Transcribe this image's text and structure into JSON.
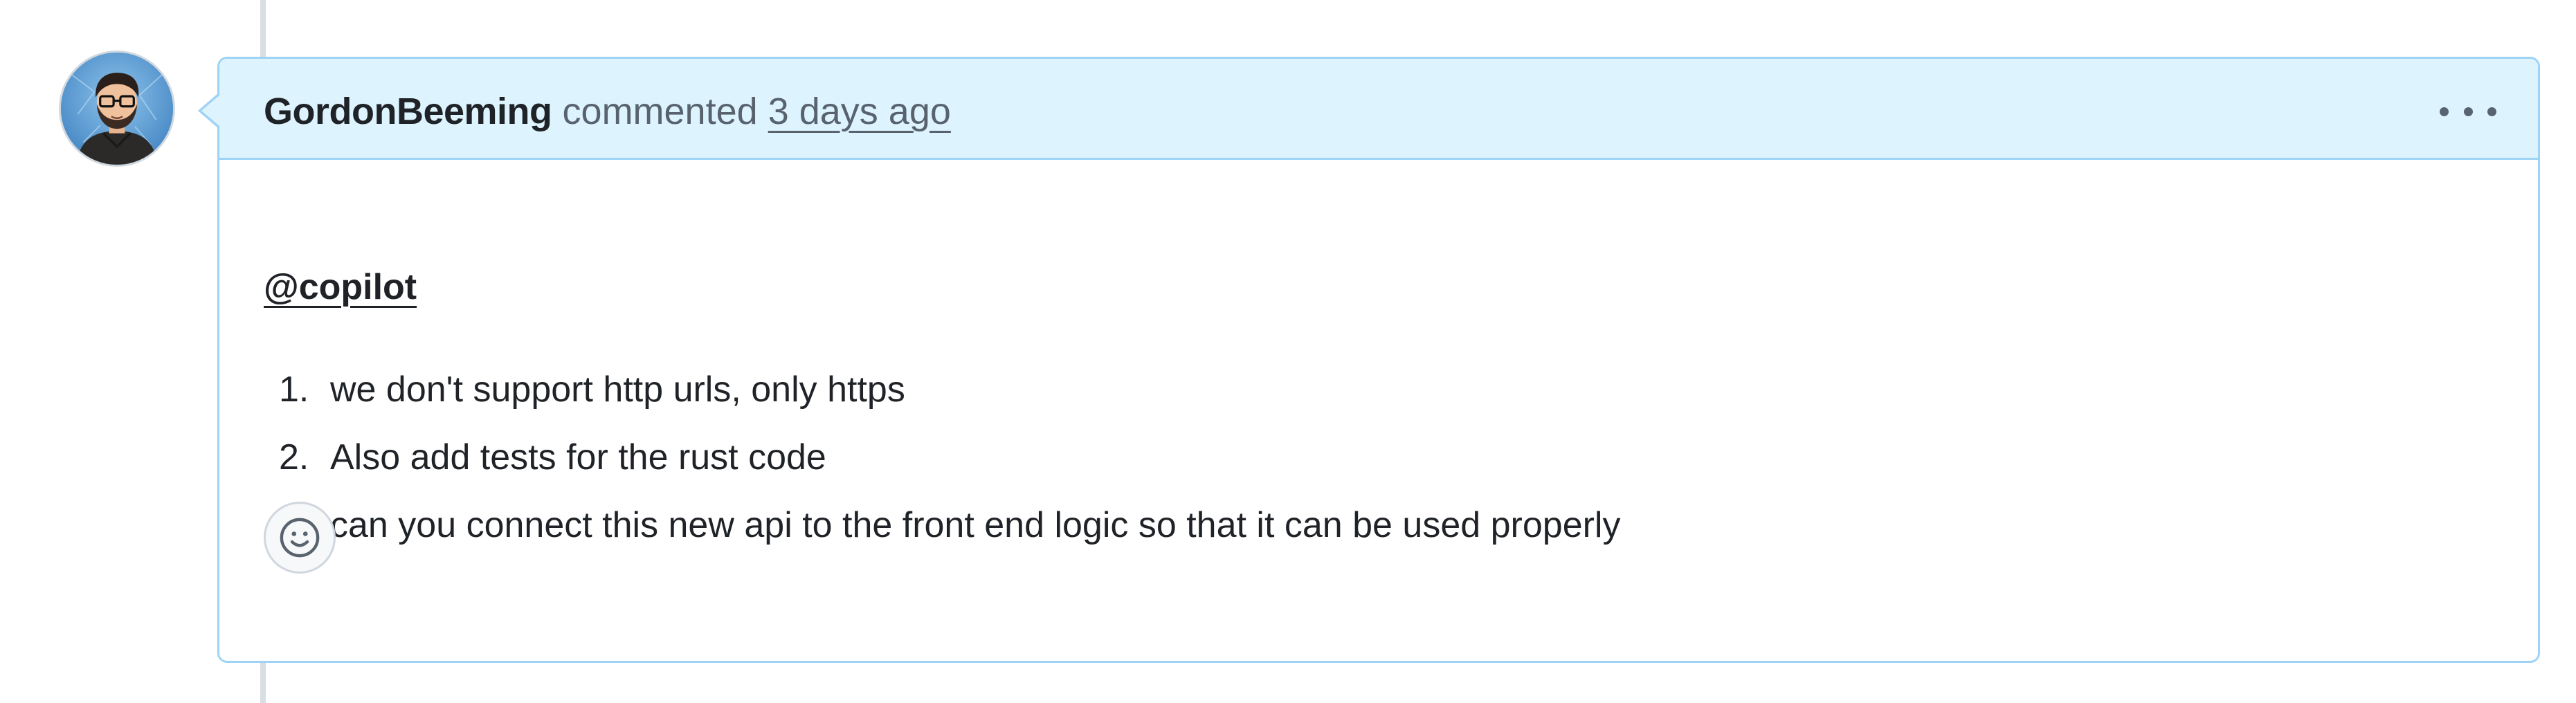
{
  "comment": {
    "author": "GordonBeeming",
    "action": "commented",
    "timestamp": "3 days ago",
    "menu_icon": "kebab-horizontal-icon",
    "mention": "@copilot",
    "items": [
      {
        "number": "1.",
        "text": "we don't support http urls, only https"
      },
      {
        "number": "2.",
        "text": "Also add tests for the rust code"
      },
      {
        "number": "3.",
        "text": "can you connect this new api to the front end logic so that it can be used properly"
      }
    ],
    "reaction_icon": "smiley-icon"
  },
  "colors": {
    "header_bg": "#ddf4ff",
    "border": "#9fd3f5",
    "text_primary": "#1f2328",
    "text_muted": "#59636e",
    "timeline": "#d8dee4"
  }
}
